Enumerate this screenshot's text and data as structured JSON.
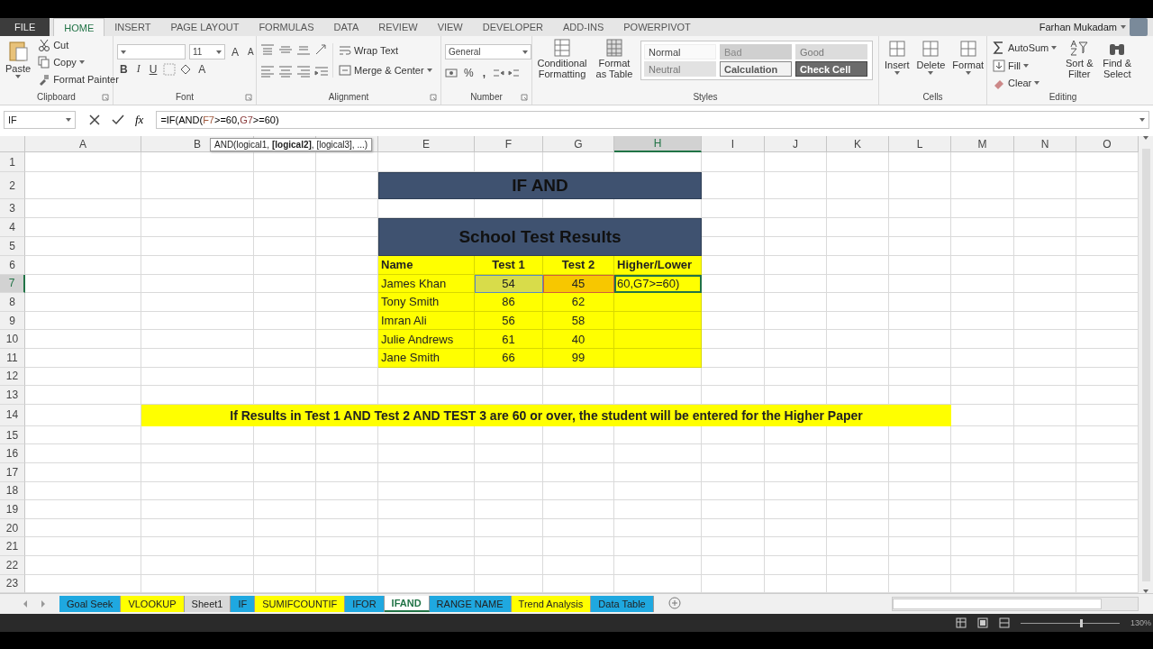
{
  "ribbon_tabs": [
    {
      "label": "FILE",
      "kind": "file",
      "selected": false
    },
    {
      "label": "HOME",
      "kind": "tab",
      "selected": true
    },
    {
      "label": "INSERT",
      "kind": "tab",
      "selected": false
    },
    {
      "label": "PAGE LAYOUT",
      "kind": "tab",
      "selected": false
    },
    {
      "label": "FORMULAS",
      "kind": "tab",
      "selected": false
    },
    {
      "label": "DATA",
      "kind": "tab",
      "selected": false
    },
    {
      "label": "REVIEW",
      "kind": "tab",
      "selected": false
    },
    {
      "label": "VIEW",
      "kind": "tab",
      "selected": false
    },
    {
      "label": "DEVELOPER",
      "kind": "tab",
      "selected": false
    },
    {
      "label": "ADD-INS",
      "kind": "tab",
      "selected": false
    },
    {
      "label": "POWERPIVOT",
      "kind": "tab",
      "selected": false
    }
  ],
  "account": {
    "name": "Farhan Mukadam"
  },
  "clipboard": {
    "label": "Clipboard",
    "paste": "Paste",
    "cut": "Cut",
    "copy": "Copy",
    "format_painter": "Format Painter"
  },
  "font": {
    "label": "Font",
    "size": "11",
    "grow": "A",
    "shrink": "A",
    "bold": "B",
    "italic": "I",
    "underline": "U",
    "font_color": "A"
  },
  "alignment": {
    "label": "Alignment",
    "wrap_text": "Wrap Text",
    "merge": "Merge & Center"
  },
  "number": {
    "label": "Number",
    "format": "General",
    "percent": "%",
    "comma": ","
  },
  "styles": {
    "label": "Styles",
    "conditional": "Conditional Formatting",
    "format_table": "Format as Table",
    "cell_styles": [
      {
        "label": "Normal",
        "kind": "normal"
      },
      {
        "label": "Bad",
        "kind": "bad"
      },
      {
        "label": "Good",
        "kind": "good"
      },
      {
        "label": "Neutral",
        "kind": "neutral"
      },
      {
        "label": "Calculation",
        "kind": "calculation"
      },
      {
        "label": "Check Cell",
        "kind": "check"
      }
    ]
  },
  "cells": {
    "label": "Cells",
    "buttons": [
      "Insert",
      "Delete",
      "Format"
    ]
  },
  "editing": {
    "label": "Editing",
    "autosum": "AutoSum",
    "fill": "Fill",
    "clear": "Clear",
    "sort": "Sort & Filter",
    "find": "Find & Select"
  },
  "formula_bar": {
    "name_box": "IF",
    "function_button": "fx",
    "formula": [
      {
        "text": "=IF(AND(",
        "color": "#000000"
      },
      {
        "text": "F7",
        "color": "#a0583c"
      },
      {
        "text": ">=60,",
        "color": "#000000"
      },
      {
        "text": "G7",
        "color": "#8a3c3c"
      },
      {
        "text": ">=60)",
        "color": "#000000"
      }
    ],
    "tooltip": "AND(logical1, **[logical2]**, [logical3], ...)"
  },
  "sheet": {
    "columns": [
      {
        "label": "A",
        "selected": false
      },
      {
        "label": "B",
        "selected": false
      },
      {
        "selected": false
      },
      {
        "selected": false
      },
      {
        "label": "E",
        "selected": false
      },
      {
        "label": "F",
        "selected": false
      },
      {
        "label": "G",
        "selected": false
      },
      {
        "label": "H",
        "selected": true
      },
      {
        "label": "I",
        "selected": false
      },
      {
        "label": "J",
        "selected": false
      },
      {
        "label": "K",
        "selected": false
      },
      {
        "label": "L",
        "selected": false
      },
      {
        "label": "M",
        "selected": false
      },
      {
        "label": "N",
        "selected": false
      },
      {
        "label": "O",
        "selected": false
      }
    ],
    "rows": [
      {
        "label": "1",
        "selected": false
      },
      {
        "label": "2",
        "selected": false
      },
      {
        "label": "3",
        "selected": false
      },
      {
        "label": "4",
        "selected": false
      },
      {
        "label": "5",
        "selected": false
      },
      {
        "label": "6",
        "selected": false
      },
      {
        "label": "7",
        "selected": true
      },
      {
        "label": "8",
        "selected": false
      },
      {
        "label": "9",
        "selected": false
      },
      {
        "label": "10",
        "selected": false
      },
      {
        "label": "11",
        "selected": false
      },
      {
        "label": "12",
        "selected": false
      },
      {
        "label": "13",
        "selected": false
      },
      {
        "label": "14",
        "selected": false
      },
      {
        "label": "15",
        "selected": false
      },
      {
        "label": "16",
        "selected": false
      },
      {
        "label": "17",
        "selected": false
      },
      {
        "label": "18",
        "selected": false
      },
      {
        "label": "19",
        "selected": false
      },
      {
        "label": "20",
        "selected": false
      },
      {
        "label": "21",
        "selected": false
      },
      {
        "label": "22",
        "selected": false
      },
      {
        "label": "23",
        "selected": false
      }
    ],
    "title": "IF AND",
    "subtitle": "School Test Results",
    "table": {
      "columns": [
        "Name",
        "Test 1",
        "Test 2",
        "Higher/Lower"
      ],
      "rows": [
        {
          "cells": [
            "James Khan",
            "54",
            "45",
            "60,G7>=60)"
          ],
          "editing": true
        },
        {
          "cells": [
            "Tony Smith",
            "86",
            "62"
          ],
          "editing": false
        },
        {
          "cells": [
            "Imran Ali",
            "56",
            "58"
          ],
          "editing": false
        },
        {
          "cells": [
            "Julie Andrews",
            "61",
            "40"
          ],
          "editing": false
        },
        {
          "cells": [
            "Jane Smith",
            "66",
            "99"
          ],
          "editing": false
        }
      ]
    },
    "note": "If Results in Test 1 AND Test 2 AND TEST 3 are 60 or over, the student will be entered for the Higher Paper"
  },
  "sheet_tabs": [
    {
      "label": "Goal Seek",
      "color": "#1fa8e0",
      "selected": false
    },
    {
      "label": "VLOOKUP",
      "color": "#ffff00",
      "selected": false
    },
    {
      "label": "Sheet1",
      "selected": false
    },
    {
      "label": "IF",
      "color": "#1fa8e0",
      "selected": false
    },
    {
      "label": "SUMIFCOUNTIF",
      "color": "#ffff00",
      "selected": false
    },
    {
      "label": "IFOR",
      "color": "#1fa8e0",
      "selected": false
    },
    {
      "label": "IFAND",
      "selected": true
    },
    {
      "label": "RANGE NAME",
      "color": "#1fa8e0",
      "selected": false
    },
    {
      "label": "Trend Analysis",
      "color": "#ffff00",
      "selected": false
    },
    {
      "label": "Data Table",
      "color": "#1fa8e0",
      "selected": false
    }
  ],
  "status_bar": {
    "zoom": {
      "label": "130%",
      "level": 0.6
    }
  }
}
